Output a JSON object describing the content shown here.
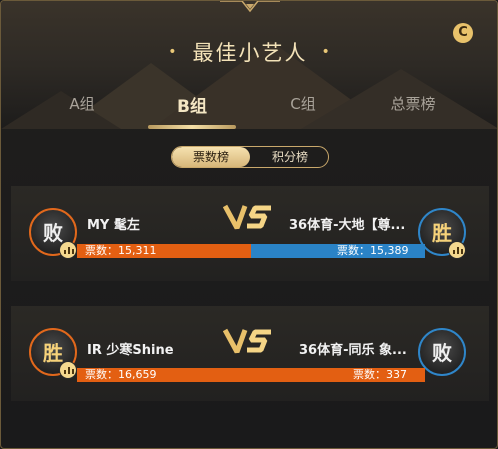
{
  "title": "最佳小艺人",
  "title_dot": "•",
  "coin_icon_glyph": "C",
  "tabs": [
    {
      "label": "A组",
      "active": false
    },
    {
      "label": "B组",
      "active": true
    },
    {
      "label": "C组",
      "active": false
    },
    {
      "label": "总票榜",
      "active": false
    }
  ],
  "segment": {
    "votes_label": "票数榜",
    "points_label": "积分榜",
    "selected": "票数榜"
  },
  "matches": [
    {
      "left": {
        "name": "MY 髦左",
        "result": "败",
        "votes_text": "票数：15,311",
        "votes": 15311,
        "color": "#e35f12"
      },
      "right": {
        "name": "36体育-大地【尊...",
        "result": "胜",
        "votes_text": "票数：15,389",
        "votes": 15389,
        "color": "#2a83c7"
      },
      "left_share": 0.499
    },
    {
      "left": {
        "name": "IR 少寒Shine",
        "result": "胜",
        "votes_text": "票数：16,659",
        "votes": 16659,
        "color": "#e35f12"
      },
      "right": {
        "name": "36体育-同乐 象...",
        "result": "败",
        "votes_text": "票数：337",
        "votes": 337,
        "color": "#e35f12"
      },
      "left_share": 0.98
    }
  ],
  "colors": {
    "accent_gold": "#f3d9a0",
    "orange": "#e35f12",
    "blue": "#2a83c7"
  }
}
